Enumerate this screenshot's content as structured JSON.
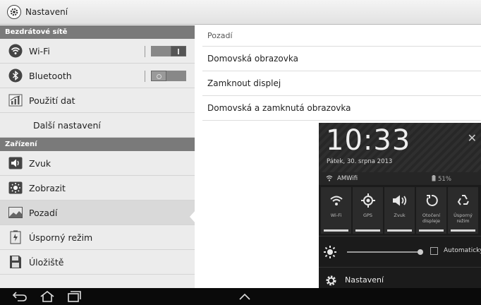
{
  "app": {
    "title": "Nastavení"
  },
  "sidebar": {
    "sections": [
      {
        "label": "Bezdrátové sítě",
        "items": [
          {
            "label": "Wi-Fi",
            "icon": "wifi-icon",
            "toggle": true,
            "on": true
          },
          {
            "label": "Bluetooth",
            "icon": "bluetooth-icon",
            "toggle": true,
            "on": false
          },
          {
            "label": "Použití dat",
            "icon": "data-usage-icon"
          },
          {
            "label": "Další nastavení"
          }
        ]
      },
      {
        "label": "Zařízení",
        "items": [
          {
            "label": "Zvuk",
            "icon": "speaker-icon"
          },
          {
            "label": "Zobrazit",
            "icon": "display-icon"
          },
          {
            "label": "Pozadí",
            "icon": "wallpaper-icon",
            "selected": true
          },
          {
            "label": "Úsporný režim",
            "icon": "power-saving-icon"
          },
          {
            "label": "Úložiště",
            "icon": "storage-icon"
          }
        ]
      }
    ]
  },
  "content": {
    "header": "Pozadí",
    "rows": [
      "Domovská obrazovka",
      "Zamknout displej",
      "Domovská a zamknutá obrazovka"
    ]
  },
  "notification_panel": {
    "time": "10:33",
    "date": "Pátek, 30. srpna 2013",
    "network": "AMWifi",
    "battery": "51%",
    "quick_toggles": [
      {
        "label": "Wi-Fi",
        "icon": "wifi-icon",
        "on": true
      },
      {
        "label": "GPS",
        "icon": "gps-icon",
        "on": true
      },
      {
        "label": "Zvuk",
        "icon": "speaker-icon",
        "on": true
      },
      {
        "label": "Otočení displeje",
        "icon": "rotate-icon",
        "on": true
      },
      {
        "label": "Úsporný režim",
        "icon": "recycle-icon",
        "on": true
      }
    ],
    "brightness_auto_label": "Automaticky",
    "settings_label": "Nastavení"
  },
  "colors": {
    "section_bg": "#7a7a7a",
    "panel_bg": "#1b1b1b",
    "navbar_bg": "#0a0a0a"
  }
}
